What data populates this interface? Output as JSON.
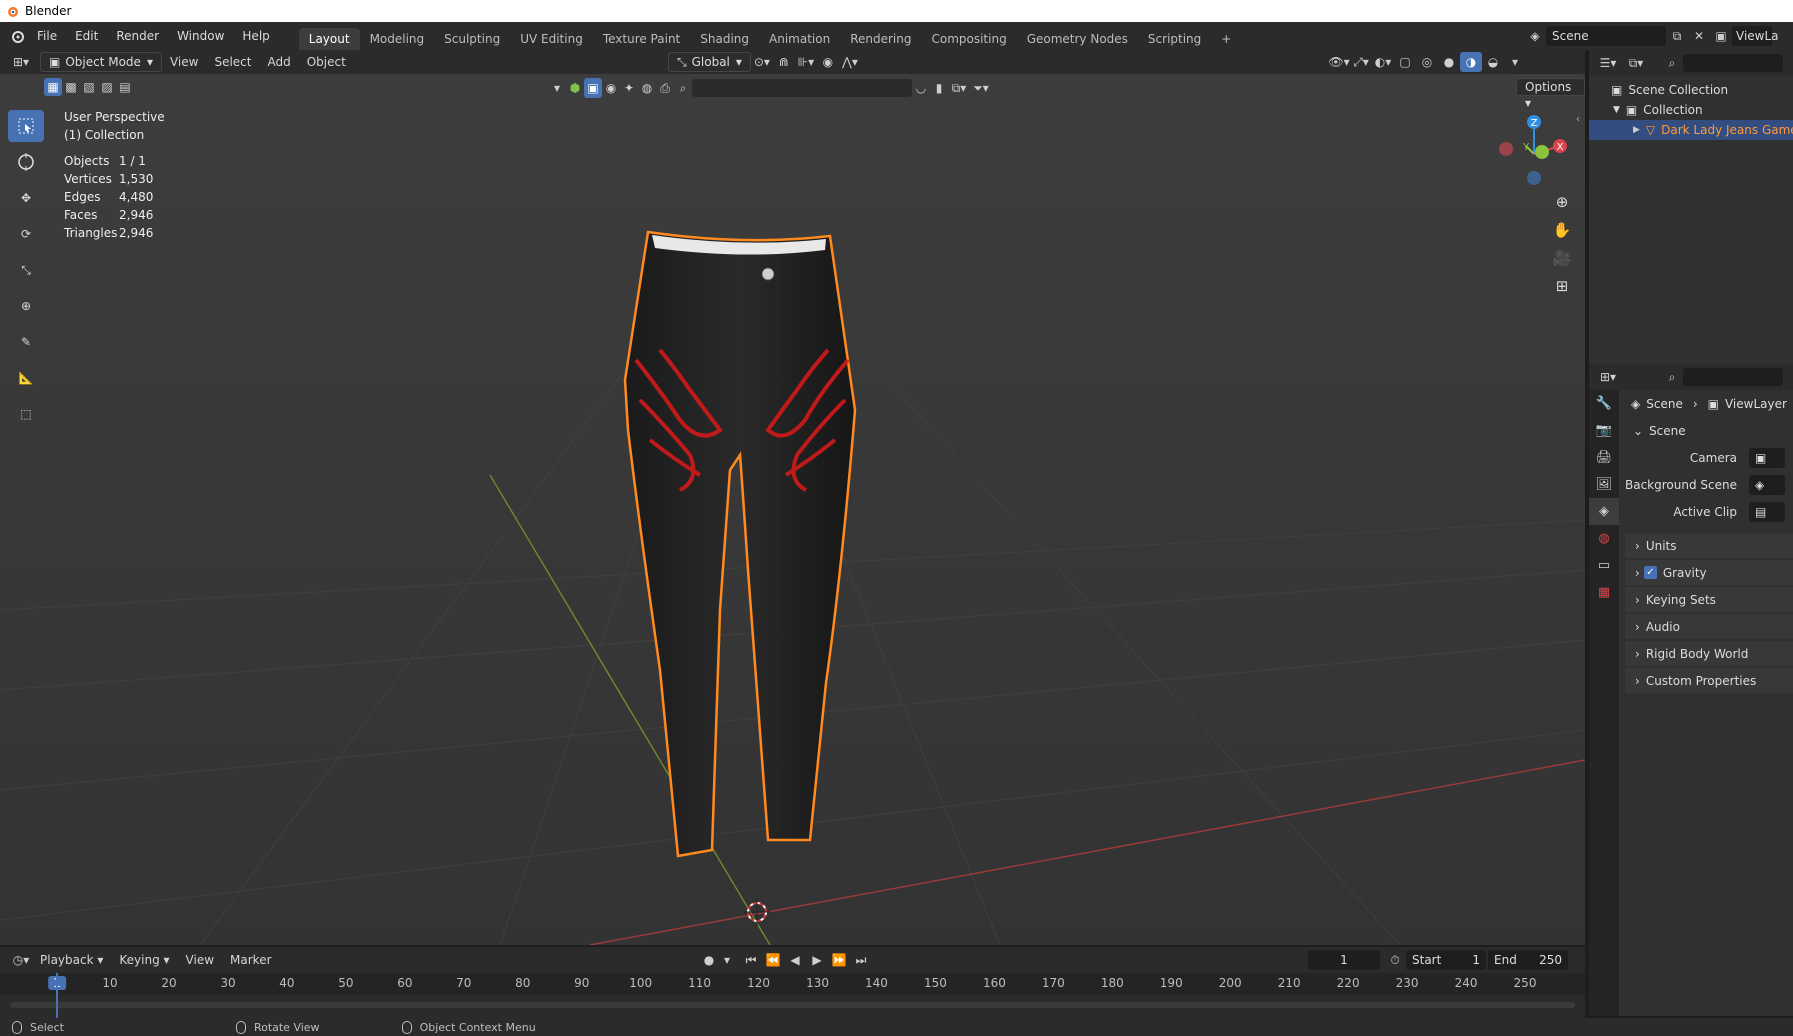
{
  "app": {
    "window_title": "Blender",
    "menus": [
      "File",
      "Edit",
      "Render",
      "Window",
      "Help"
    ],
    "workspaces": [
      "Layout",
      "Modeling",
      "Sculpting",
      "UV Editing",
      "Texture Paint",
      "Shading",
      "Animation",
      "Rendering",
      "Compositing",
      "Geometry Nodes",
      "Scripting"
    ],
    "active_workspace": "Layout",
    "add_workspace": "+",
    "scene_name": "Scene",
    "view_layer_name": "ViewLa"
  },
  "viewport": {
    "mode": "Object Mode",
    "menus": [
      "View",
      "Select",
      "Add",
      "Object"
    ],
    "transform_orientation": "Global",
    "options_label": "Options",
    "overlay": {
      "perspective": "User Perspective",
      "collection": "(1) Collection"
    },
    "stats": [
      {
        "label": "Objects",
        "value": "1 / 1"
      },
      {
        "label": "Vertices",
        "value": "1,530"
      },
      {
        "label": "Edges",
        "value": "4,480"
      },
      {
        "label": "Faces",
        "value": "2,946"
      },
      {
        "label": "Triangles",
        "value": "2,946"
      }
    ],
    "gizmo_axes": {
      "x": "X",
      "y": "Y",
      "z": "Z"
    }
  },
  "outliner": {
    "rows": [
      {
        "label": "Scene Collection"
      },
      {
        "label": "Collection"
      },
      {
        "label": "Dark Lady Jeans Game R"
      }
    ]
  },
  "properties": {
    "breadcrumb": {
      "scene": "Scene",
      "view_layer": "ViewLayer"
    },
    "section_title": "Scene",
    "fields": [
      {
        "label": "Camera"
      },
      {
        "label": "Background Scene"
      },
      {
        "label": "Active Clip"
      }
    ],
    "panels": [
      "Units",
      "Gravity",
      "Keying Sets",
      "Audio",
      "Rigid Body World",
      "Custom Properties"
    ],
    "gravity_checked": true
  },
  "timeline": {
    "menus": [
      "Playback",
      "Keying",
      "View",
      "Marker"
    ],
    "current_frame": "1",
    "start_label": "Start",
    "start_value": "1",
    "end_label": "End",
    "end_value": "250",
    "ruler_ticks": [
      "1",
      "10",
      "20",
      "30",
      "40",
      "50",
      "60",
      "70",
      "80",
      "90",
      "100",
      "110",
      "120",
      "130",
      "140",
      "150",
      "160",
      "170",
      "180",
      "190",
      "200",
      "210",
      "220",
      "230",
      "240",
      "250"
    ]
  },
  "statusbar": {
    "select": "Select",
    "rotate": "Rotate View",
    "context": "Object Context Menu"
  },
  "colors": {
    "accent": "#4772b3",
    "selection_outline": "#ff8a1f",
    "x_axis": "#d9434b",
    "y_axis": "#8bc43e",
    "z_axis": "#2f8fe0"
  }
}
